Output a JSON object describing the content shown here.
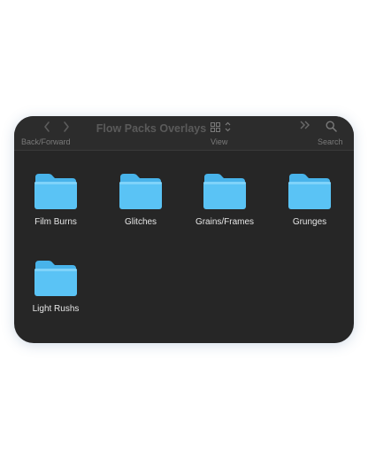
{
  "window": {
    "title": "Flow Packs Overlays"
  },
  "toolbar": {
    "back_icon": "chevron-left-icon",
    "forward_icon": "chevron-right-icon",
    "nav_label": "Back/Forward",
    "view_icon": "icon-grid-icon",
    "view_label": "View",
    "more_icon": "double-chevron-right-icon",
    "search_icon": "magnifier-icon",
    "search_label": "Search"
  },
  "folders": [
    {
      "label": "Film Burns"
    },
    {
      "label": "Glitches"
    },
    {
      "label": "Grains/Frames"
    },
    {
      "label": "Grunges"
    },
    {
      "label": "Light Rushs"
    }
  ],
  "colors": {
    "window_bg": "#262626",
    "toolbar_bg": "#2c2c2c",
    "folder_blue": "#5ac3f5",
    "folder_blue_light": "#7fd3fa",
    "label_text": "#e6e6e6",
    "muted_text": "#7a7a7a"
  }
}
